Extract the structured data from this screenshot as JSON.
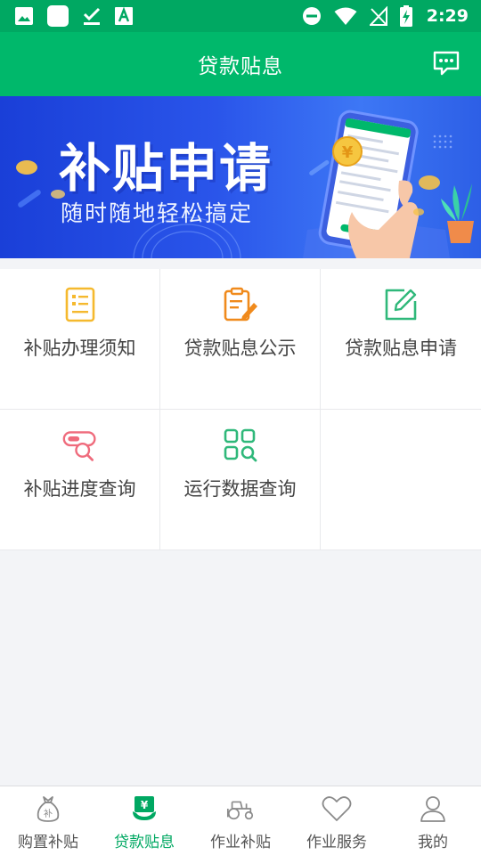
{
  "status_bar": {
    "time": "2:29",
    "icons": [
      "image-icon",
      "square-app-icon",
      "download-done-icon",
      "font-a-icon",
      "do-not-disturb-icon",
      "wifi-icon",
      "no-signal-icon",
      "battery-charging-icon"
    ]
  },
  "header": {
    "title": "贷款贴息",
    "message_icon": "chat-bubble-icon"
  },
  "banner": {
    "title": "补贴申请",
    "subtitle": "随时随地轻松搞定"
  },
  "menu": {
    "items": [
      {
        "label": "补贴办理须知",
        "icon": "notice-list-icon",
        "color": "#f5b92e"
      },
      {
        "label": "贷款贴息公示",
        "icon": "clipboard-pen-icon",
        "color": "#f08a1c"
      },
      {
        "label": "贷款贴息申请",
        "icon": "edit-square-icon",
        "color": "#2fb87a"
      },
      {
        "label": "补贴进度查询",
        "icon": "progress-search-icon",
        "color": "#ef6b7c"
      },
      {
        "label": "运行数据查询",
        "icon": "grid-search-icon",
        "color": "#2fb87a"
      }
    ]
  },
  "bottom_nav": {
    "items": [
      {
        "label": "购置补贴",
        "icon": "subsidy-bag-icon"
      },
      {
        "label": "贷款贴息",
        "icon": "loan-yen-icon"
      },
      {
        "label": "作业补贴",
        "icon": "tractor-icon"
      },
      {
        "label": "作业服务",
        "icon": "heart-icon"
      },
      {
        "label": "我的",
        "icon": "user-icon"
      }
    ],
    "active_color": "#00a862",
    "inactive_color": "#8a8a8a"
  },
  "colors": {
    "brand_green": "#00b86b",
    "status_green": "#00a862"
  }
}
